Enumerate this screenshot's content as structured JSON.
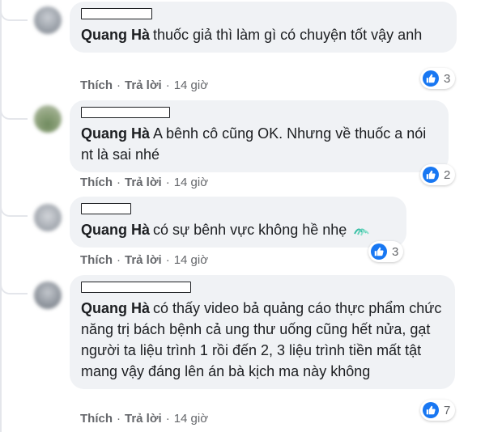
{
  "colors": {
    "bubble_bg": "#f0f2f5",
    "action_text": "#65676b",
    "like_blue": "#1877f2",
    "thread_line": "#e4e6eb"
  },
  "comments": [
    {
      "author": "Quang Hà",
      "text": "thuốc giả thì làm gì có chuyện tốt vậy anh",
      "like_label": "Thích",
      "reply_label": "Trả lời",
      "time": "14 giờ",
      "reaction_icon": "like-icon",
      "reaction_count": "3"
    },
    {
      "author": "Quang Hà",
      "text": "A bênh cô cũng OK. Nhưng về thuốc a nói nt là sai nhé",
      "like_label": "Thích",
      "reply_label": "Trả lời",
      "time": "14 giờ",
      "reaction_icon": "like-icon",
      "reaction_count": "2"
    },
    {
      "author": "Quang Hà",
      "text": "có sự bênh vực không hề nhẹ",
      "sticker": "cold-sweat-emoji-icon",
      "like_label": "Thích",
      "reply_label": "Trả lời",
      "time": "14 giờ",
      "reaction_icon": "like-icon",
      "reaction_count": "3"
    },
    {
      "author": "Quang Hà",
      "text": "có thấy video bả quảng cáo thực phẩm chức năng trị bách bệnh cả ung thư uống cũng hết nửa, gạt người ta liệu trình 1 rồi đến 2, 3 liệu trình tiền mất tật mang vậy đáng lên án bà kịch ma này không",
      "like_label": "Thích",
      "reply_label": "Trả lời",
      "time": "14 giờ",
      "reaction_icon": "like-icon",
      "reaction_count": "7"
    }
  ]
}
